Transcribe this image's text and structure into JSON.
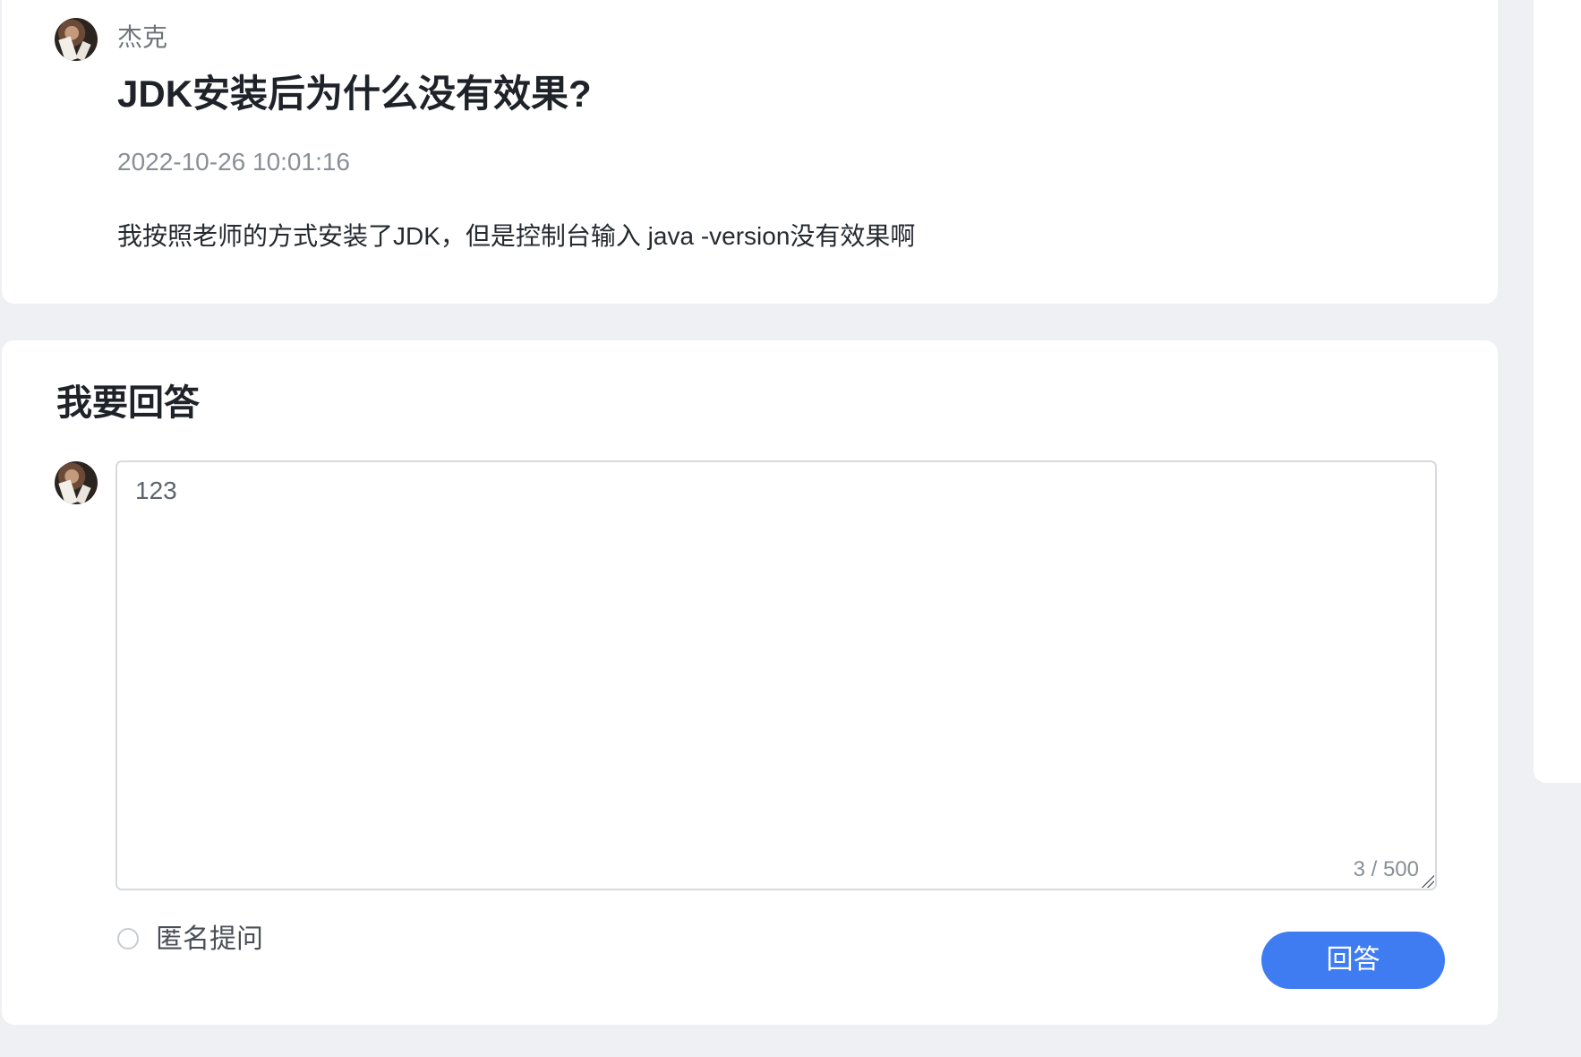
{
  "question": {
    "author": "杰克",
    "title": "JDK安装后为什么没有效果?",
    "date": "2022-10-26 10:01:16",
    "body": "我按照老师的方式安装了JDK，但是控制台输入 java -version没有效果啊"
  },
  "answer_form": {
    "title": "我要回答",
    "input_value": "123",
    "char_count": "3 / 500",
    "anonymous_label": "匿名提问",
    "submit_label": "回答"
  },
  "colors": {
    "page_background": "#eef0f4",
    "card_background": "#ffffff",
    "primary": "#3f7cf2"
  },
  "icons": {
    "author_avatar": "avatar",
    "answer_avatar": "avatar",
    "resize_handle": "resize-handle-icon",
    "anonymous_option": "radio-unchecked"
  }
}
